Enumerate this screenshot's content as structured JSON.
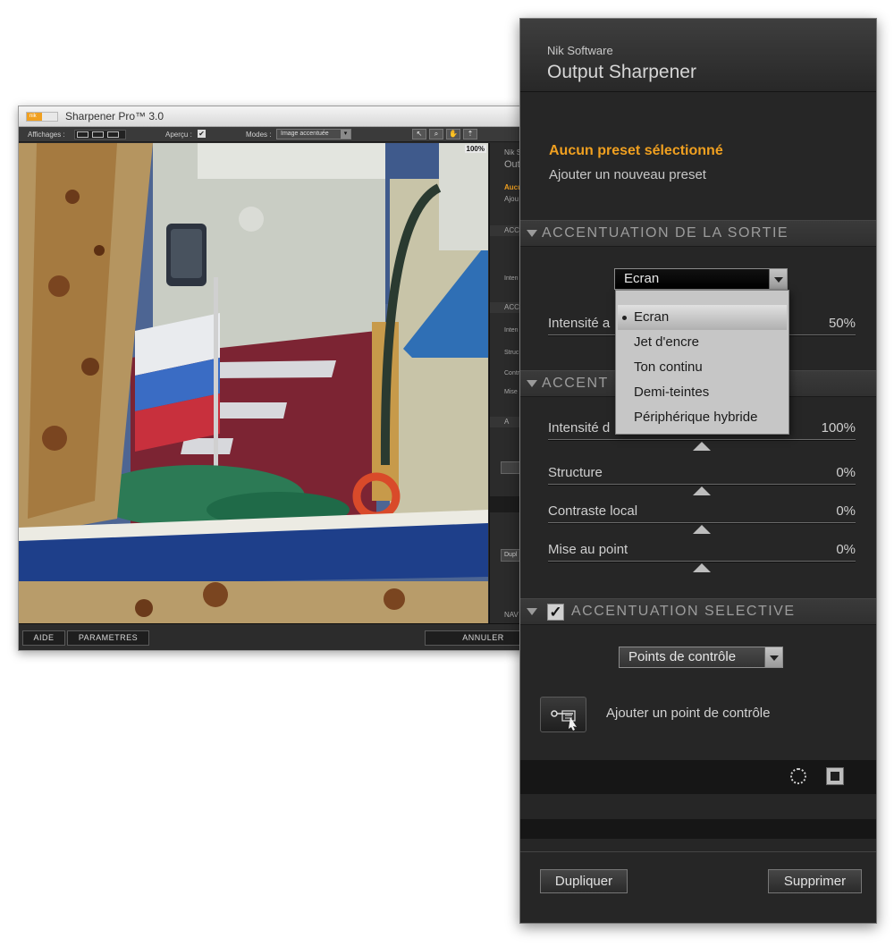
{
  "app": {
    "title": "Sharpener Pro™ 3.0",
    "logo_text": "nik",
    "toolbar": {
      "views_label": "Affichages :",
      "preview_label": "Aperçu :",
      "preview_check": "✔",
      "modes_label": "Modes :",
      "mode_value": "Image accentuée",
      "zoom_value": "100%"
    },
    "side_peek": [
      "Nik So",
      "Outp",
      "Aucu",
      "Ajou",
      "ACC",
      "Inten",
      "ACC",
      "Inten",
      "Struc",
      "Contr",
      "Mise",
      "A",
      "Dupl",
      "NAV"
    ],
    "bottom": {
      "help_label": "AIDE",
      "settings_label": "PARAMETRES",
      "cancel_label": "ANNULER"
    }
  },
  "panel": {
    "brand": "Nik Software",
    "title": "Output Sharpener",
    "preset_none": "Aucun preset sélectionné",
    "preset_add": "Ajouter un nouveau preset",
    "output_section": {
      "title": "ACCENTUATION DE LA SORTIE",
      "dropdown_value": "Ecran",
      "menu_items": [
        "Ecran",
        "Jet d'encre",
        "Ton continu",
        "Demi-teintes",
        "Périphérique hybride"
      ],
      "menu_selected_index": 0,
      "slider": {
        "label": "Intensité a",
        "value": "50%"
      }
    },
    "creative_section": {
      "title": "ACCENT",
      "sliders": [
        {
          "label": "Intensité d",
          "value": "100%",
          "level": 0.5
        },
        {
          "label": "Structure",
          "value": "0%",
          "level": 0.5
        },
        {
          "label": "Contraste local",
          "value": "0%",
          "level": 0.5
        },
        {
          "label": "Mise au point",
          "value": "0%",
          "level": 0.5
        }
      ]
    },
    "selective_section": {
      "title": "ACCENTUATION SELECTIVE",
      "checked": "✓",
      "dropdown_value": "Points de contrôle",
      "add_point_label": "Ajouter un point de contrôle"
    },
    "footer": {
      "duplicate_label": "Dupliquer",
      "delete_label": "Supprimer"
    },
    "colors": {
      "accent": "#f0a020",
      "panel_bg": "#262626"
    },
    "icons": {
      "section_toggle": "triangle-down",
      "control_point": "control-point-tool",
      "circle": "dotted-circle",
      "mask": "mask-square"
    }
  }
}
